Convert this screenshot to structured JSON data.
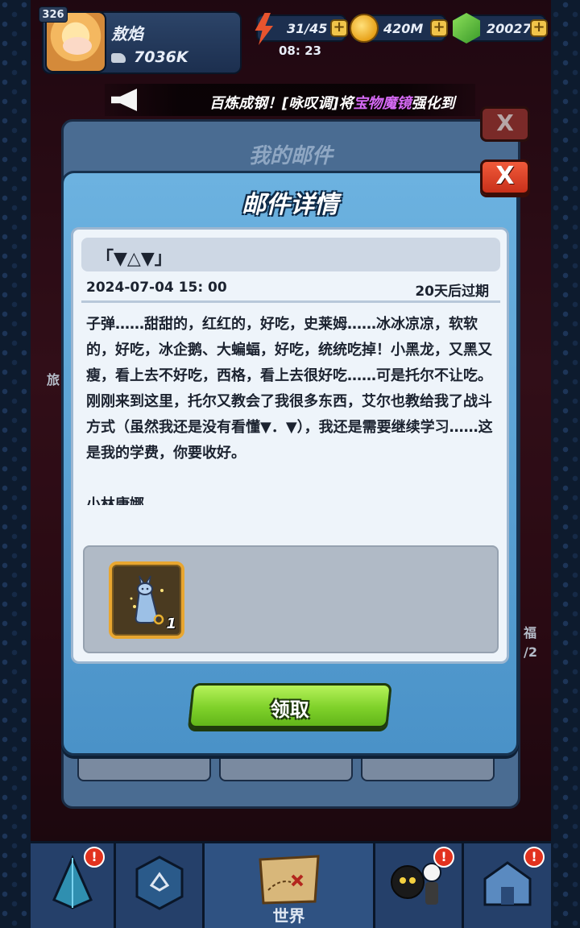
{
  "player": {
    "level": "326",
    "name": "敖焰",
    "power": "7036K"
  },
  "resources": {
    "energy": "31/45",
    "energy_timer": "08: 23",
    "gold": "420M",
    "gems": "20027",
    "plus_label": "+"
  },
  "announcement": {
    "prefix": "百炼成钢！[咏叹调]将",
    "highlight": "宝物魔镜",
    "suffix": "强化到",
    "highlight_color": "#d66af5"
  },
  "background_window": {
    "title": "我的邮件",
    "close_label": "X"
  },
  "dialog": {
    "title": "邮件详情",
    "close_label": "X"
  },
  "mail": {
    "subject": "「▼△▼」",
    "date": "2024-07-04 15: 00",
    "expire": "20天后过期",
    "body_paragraphs": [
      "子弹……甜甜的，红红的，好吃，史莱姆……冰冰凉凉，软软的，好吃，冰企鹅、大蝙蝠，好吃，统统吃掉！小黑龙，又黑又瘦，看上去不好吃，西格，看上去很好吃……可是托尔不让吃。",
      "刚刚来到这里，托尔又教会了我很多东西，艾尔也教给我了战斗方式（虽然我还是没有看懂▼．▼），我还是需要继续学习……这是我的学费，你要收好。"
    ],
    "signature": "小林康娜"
  },
  "attachment": {
    "item_icon": "rabbit-bottle-icon",
    "count": "1"
  },
  "claim_button": {
    "label": "领取"
  },
  "side_hints": {
    "right_text": "福",
    "right_count": "/2",
    "left_text": "旅"
  },
  "bottom_nav": {
    "items": [
      {
        "label": "",
        "icon": "crystal-icon",
        "alert": "!"
      },
      {
        "label": "",
        "icon": "hex-rune-icon",
        "alert": ""
      },
      {
        "label": "世界",
        "icon": "treasure-map-icon",
        "alert": ""
      },
      {
        "label": "",
        "icon": "team-heroes-icon",
        "alert": "!"
      },
      {
        "label": "",
        "icon": "castle-icon",
        "alert": "!"
      }
    ]
  },
  "colors": {
    "accent_green": "#7fd12a",
    "dialog_blue": "#4a92c8",
    "close_red": "#e0401f"
  }
}
